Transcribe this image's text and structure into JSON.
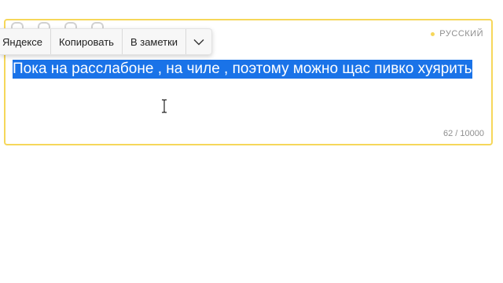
{
  "language": {
    "label": "РУССКИЙ",
    "dot_color": "#f6d75a"
  },
  "context_menu": {
    "items": [
      {
        "label": "Яндексе"
      },
      {
        "label": "Копировать"
      },
      {
        "label": "В заметки"
      }
    ],
    "more_icon": "chevron-down-icon"
  },
  "input": {
    "text": "Пока на расслабоне , на чиле , поэтому можно щас пивко хуярить",
    "selection_color": "#1a73e8"
  },
  "counter": {
    "text": "62 / 10000"
  },
  "theme": {
    "border_color": "#f6d75a"
  }
}
